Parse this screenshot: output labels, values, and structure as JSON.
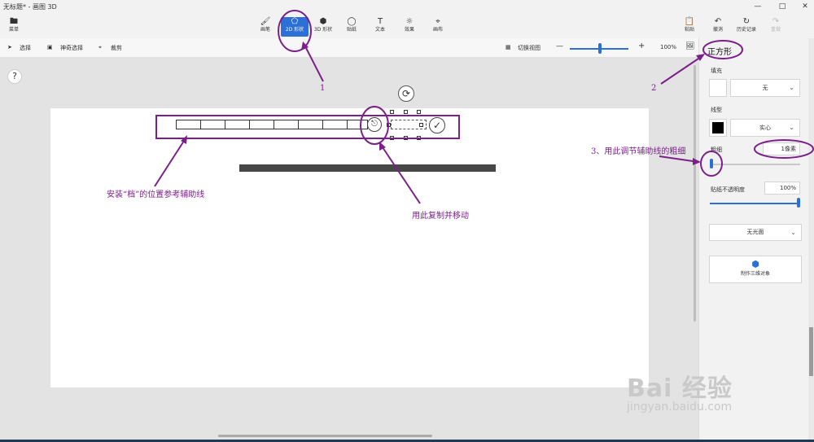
{
  "window": {
    "title": "无标题* - 画图 3D",
    "controls": [
      "—",
      "□",
      "✕"
    ]
  },
  "toolbar": {
    "menu": {
      "icon": "folder-icon",
      "label": "菜单"
    },
    "tools": [
      {
        "icon": "brush-icon",
        "label": "画笔"
      },
      {
        "icon": "2d-shapes-icon",
        "label": "2D 形状"
      },
      {
        "icon": "3d-shapes-icon",
        "label": "3D 形状"
      },
      {
        "icon": "stickers-icon",
        "label": "贴纸"
      },
      {
        "icon": "text-icon",
        "label": "文本"
      },
      {
        "icon": "effects-icon",
        "label": "效果"
      },
      {
        "icon": "canvas-icon",
        "label": "画布"
      }
    ],
    "actions": [
      {
        "icon": "paste-icon",
        "label": "粘贴"
      },
      {
        "icon": "undo-icon",
        "label": "撤消"
      },
      {
        "icon": "history-icon",
        "label": "历史记录"
      },
      {
        "icon": "redo-icon",
        "label": "重做"
      }
    ],
    "active_tool": "2D 形状"
  },
  "subbar": {
    "select": "选择",
    "magic_select": "神奇选择",
    "crop": "裁剪",
    "switch_view": "切换视图",
    "zoom_minus": "—",
    "zoom_plus": "+",
    "zoom": "100%",
    "zoom_level": 0.5
  },
  "help": "?",
  "panel": {
    "title": "正方形",
    "fill_label": "填充",
    "fill_value": "无",
    "line_label": "线型",
    "line_value": "实心",
    "line_color": "#000000",
    "thickness_label": "粗细",
    "thickness_value": "1像素",
    "sticker_opacity_label": "贴纸不透明度",
    "sticker_opacity_value": "100%",
    "finish": "无光面",
    "make3d": "制作三维对象"
  },
  "annotations": {
    "n1": "1",
    "n2": "2",
    "n3": "3、用此调节辅助线的粗细",
    "guide": "安装“档”的位置参考辅助线",
    "copy": "用此复制并移动"
  },
  "colors": {
    "accent": "#2c6fd6",
    "annotation": "#7b1f8a",
    "thick_bar": "#474747"
  },
  "watermark": {
    "brand": "Bai 经验",
    "url": "jingyan.baidu.com"
  }
}
